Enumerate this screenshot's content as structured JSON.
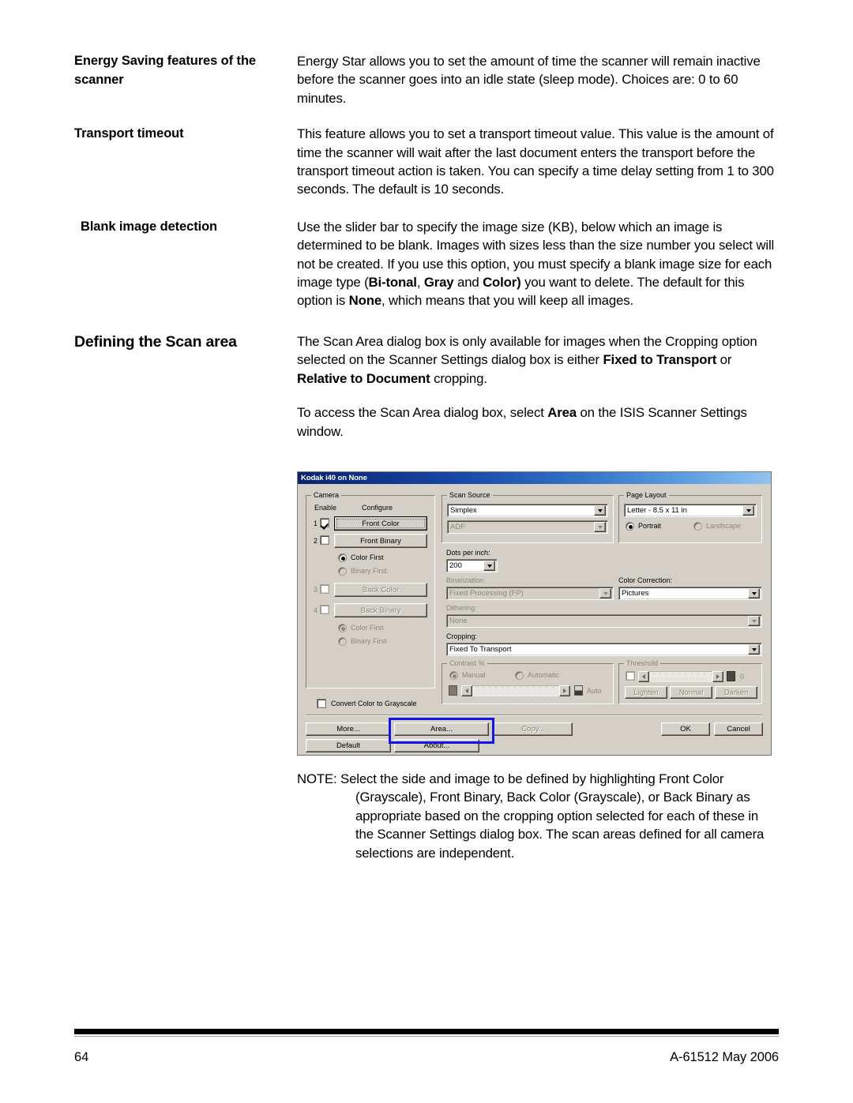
{
  "page": {
    "number": "64",
    "doc_code": "A-61512 May 2006"
  },
  "sections": [
    {
      "term": "Energy Saving features of the scanner",
      "paragraphs": [
        "Energy Star allows you to set the amount of time the scanner will remain inactive before the scanner goes into an idle state (sleep mode). Choices are: 0 to 60 minutes."
      ]
    },
    {
      "term": "Transport timeout",
      "paragraphs": [
        "This feature allows you to set a transport timeout value. This value is the amount of time the scanner will wait after the last document enters the transport before the transport timeout action is taken. You can specify a time delay setting from 1 to 300 seconds. The default is 10 seconds."
      ]
    },
    {
      "term": "Blank image detection",
      "body_parts": {
        "p1a": "Use the slider bar to specify the image size (KB), below which an image is determined to be blank. Images with sizes less than the size number you select will not be created. If you use this option, you must specify a blank image size for each image type (",
        "b1": "Bi-tonal",
        "p1b": ", ",
        "b2": "Gray",
        "p1c": " and ",
        "b3": "Color)",
        "p1d": " you want to delete. The default for this option is ",
        "b4": "None",
        "p1e": ", which means that you will keep all images."
      }
    },
    {
      "term": "Defining the Scan area",
      "body_parts": {
        "p1a": "The Scan Area dialog box is only available for images when the Cropping option selected on the Scanner Settings dialog box is either ",
        "b1": "Fixed to Transport",
        "p1b": " or ",
        "b2": "Relative to Document",
        "p1c": " cropping.",
        "p2a": "To access the Scan Area dialog box, select ",
        "b3": "Area",
        "p2b": " on the ISIS Scanner Settings window."
      }
    }
  ],
  "dialog": {
    "title": "Kodak i40 on None",
    "camera": {
      "legend": "Camera",
      "col_enable": "Enable",
      "col_configure": "Configure",
      "rows": [
        {
          "index": "1",
          "label": "Front Color",
          "checked": true,
          "enabled": true,
          "focused": true
        },
        {
          "index": "2",
          "label": "Front Binary",
          "checked": false,
          "enabled": true,
          "focused": false
        },
        {
          "index": "3",
          "label": "Back Color",
          "checked": false,
          "enabled": false,
          "focused": false
        },
        {
          "index": "4",
          "label": "Back Binary",
          "checked": false,
          "enabled": false,
          "focused": false
        }
      ],
      "order_front": {
        "color_first": "Color First",
        "binary_first": "Binary First",
        "selected": "Color First"
      },
      "order_back": {
        "color_first": "Color First",
        "binary_first": "Binary First",
        "selected": "Color First"
      },
      "convert_grayscale": {
        "label": "Convert Color to Grayscale",
        "checked": false
      }
    },
    "scan_source": {
      "legend": "Scan Source",
      "mode_value": "Simplex",
      "feeder_value": "ADF"
    },
    "dots_per_inch": {
      "label": "Dots per inch:",
      "value": "200"
    },
    "binarization": {
      "label": "Binarization:",
      "value": "Fixed Processing (FP)"
    },
    "dithering": {
      "label": "Dithering:",
      "value": "None"
    },
    "cropping": {
      "label": "Cropping:",
      "value": "Fixed To Transport"
    },
    "page_layout": {
      "legend": "Page Layout",
      "size_value": "Letter - 8.5 x 11 in",
      "portrait": "Portrait",
      "landscape": "Landscape",
      "orientation_selected": "Portrait"
    },
    "color_correction": {
      "label": "Color Correction:",
      "value": "Pictures"
    },
    "contrast": {
      "legend": "Contrast %",
      "manual": "Manual",
      "automatic": "Automatic",
      "selected": "Manual",
      "auto_label": "Auto"
    },
    "threshold": {
      "legend": "Threshold",
      "value": "0",
      "lighten": "Lighten",
      "normal": "Normal",
      "darken": "Darken"
    },
    "buttons": {
      "more": "More...",
      "area": "Area...",
      "copy": "Copy...",
      "default": "Default",
      "about": "About...",
      "ok": "OK",
      "cancel": "Cancel"
    },
    "annotation_color": "#1414e6"
  },
  "note": {
    "prefix": "NOTE:",
    "text": "Select the side and image to be defined by highlighting Front Color (Grayscale), Front Binary, Back Color (Grayscale), or Back Binary as appropriate based on the cropping option selected for each of these in the Scanner Settings dialog box. The scan areas defined for all camera selections are independent."
  }
}
